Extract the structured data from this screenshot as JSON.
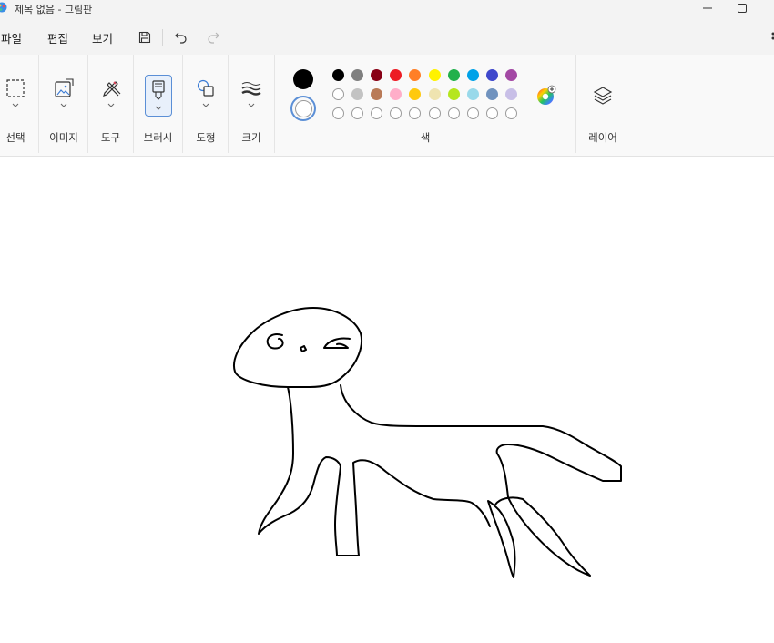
{
  "window": {
    "title": "제목 없음 - 그림판",
    "minimize_label": "—",
    "maximize_label": "☐"
  },
  "menu": {
    "file": "파일",
    "edit": "편집",
    "view": "보기"
  },
  "toolbar": {
    "save_icon": "save-icon",
    "undo_icon": "undo-icon",
    "redo_icon": "redo-icon"
  },
  "ribbon": {
    "select": "선택",
    "image": "이미지",
    "tools": "도구",
    "brushes": "브러시",
    "shapes": "도형",
    "size": "크기",
    "colors": "색",
    "layers": "레이어"
  },
  "colors": {
    "primary": "#000000",
    "secondary": "#ffffff",
    "accent": "#5b8fd6",
    "row1": [
      "#000000",
      "#7f7f7f",
      "#880015",
      "#ed1c24",
      "#ff7f27",
      "#fff200",
      "#22b14c",
      "#00a2e8",
      "#3f48cc",
      "#a349a4"
    ],
    "row2": [
      "#ffffff",
      "#c3c3c3",
      "#b97a57",
      "#ffaec9",
      "#ffc90e",
      "#efe4b0",
      "#b5e61d",
      "#99d9ea",
      "#7092be",
      "#c8bfe7"
    ],
    "row3_empty_count": 10
  }
}
